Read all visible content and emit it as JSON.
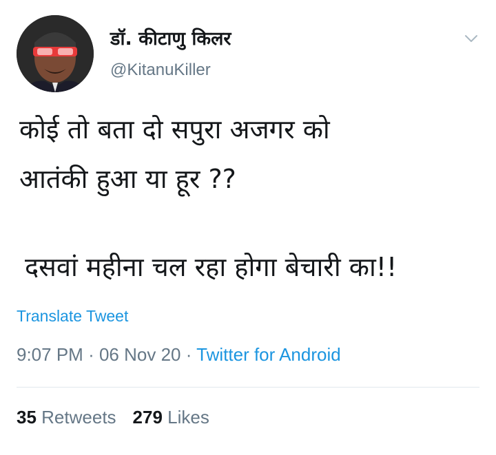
{
  "author": {
    "display_name": "डॉ. कीटाणु किलर",
    "handle": "@KitanuKiller"
  },
  "tweet": {
    "lines": [
      "कोई तो बता दो सपुरा अजगर को",
      "आतंकी हुआ या हूर ??",
      "दसवां महीना चल रहा होगा बेचारी का!!"
    ],
    "translate_label": "Translate Tweet",
    "time": "9:07 PM",
    "separator": "·",
    "date": "06 Nov 20",
    "source": "Twitter for Android"
  },
  "stats": {
    "retweets_count": "35",
    "retweets_label": "Retweets",
    "likes_count": "279",
    "likes_label": "Likes"
  },
  "icons": {
    "menu": "chevron-down-icon"
  },
  "colors": {
    "link": "#1b95e0",
    "secondary_text": "#657786",
    "primary_text": "#14171a",
    "divider": "#e1e8ed"
  }
}
